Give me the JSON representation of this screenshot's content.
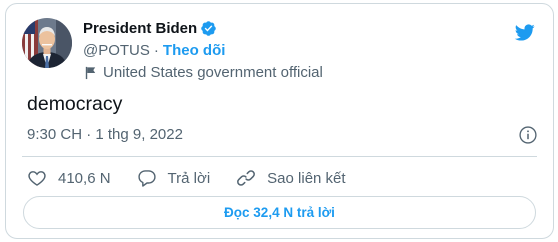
{
  "author": {
    "name": "President Biden",
    "handle": "@POTUS",
    "separator": "·",
    "follow_label": "Theo dõi",
    "account_label": "United States government official",
    "verified": true
  },
  "tweet": {
    "text": "democracy",
    "timestamp": "9:30 CH · 1 thg 9, 2022"
  },
  "actions": {
    "likes": "410,6 N",
    "reply_label": "Trả lời",
    "copy_link_label": "Sao liên kết"
  },
  "read_replies_label": "Đọc 32,4 N trả lời",
  "icons": {
    "avatar": "avatar-photo",
    "verified": "verified-badge-icon",
    "flag": "government-flag-icon",
    "brand": "twitter-bird-icon",
    "info": "info-icon",
    "like": "heart-icon",
    "reply": "reply-bubble-icon",
    "link": "link-icon"
  },
  "colors": {
    "accent": "#1d9bf0",
    "text_primary": "#0f1419",
    "text_secondary": "#536471",
    "border": "#cfd9de"
  }
}
